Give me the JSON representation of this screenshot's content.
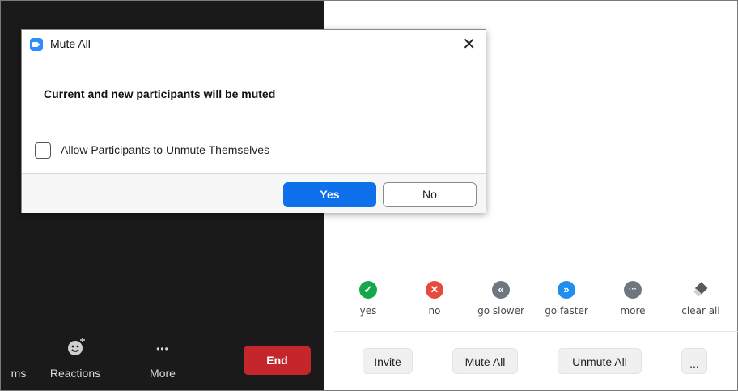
{
  "dialog": {
    "title": "Mute All",
    "close_glyph": "✕",
    "message": "Current and new participants will be muted",
    "checkbox_label": "Allow Participants to Unmute Themselves",
    "checkbox_checked": false,
    "yes_label": "Yes",
    "no_label": "No"
  },
  "toolbar": {
    "partial_label": "ms",
    "reactions_label": "Reactions",
    "more_glyph": "•••",
    "more_label": "More",
    "end_label": "End",
    "end_color": "#c4262c"
  },
  "reactions": [
    {
      "label": "yes",
      "glyph": "✓",
      "color": "#14a84a",
      "icon": "check-icon"
    },
    {
      "label": "no",
      "glyph": "✕",
      "color": "#e54b3d",
      "icon": "x-icon"
    },
    {
      "label": "go slower",
      "glyph": "«",
      "color": "#6e7680",
      "icon": "rewind-icon"
    },
    {
      "label": "go faster",
      "glyph": "»",
      "color": "#1f8ef1",
      "icon": "fast-forward-icon"
    },
    {
      "label": "more",
      "glyph": "···",
      "color": "#6e7680",
      "icon": "ellipsis-icon"
    },
    {
      "label": "clear all",
      "glyph": "",
      "color": "#5a5a5a",
      "icon": "eraser-icon"
    }
  ],
  "actions": {
    "invite": "Invite",
    "mute_all": "Mute All",
    "unmute_all": "Unmute All",
    "more": "..."
  },
  "colors": {
    "accent": "#0e71eb",
    "dark_bg": "#1a1a1a"
  }
}
